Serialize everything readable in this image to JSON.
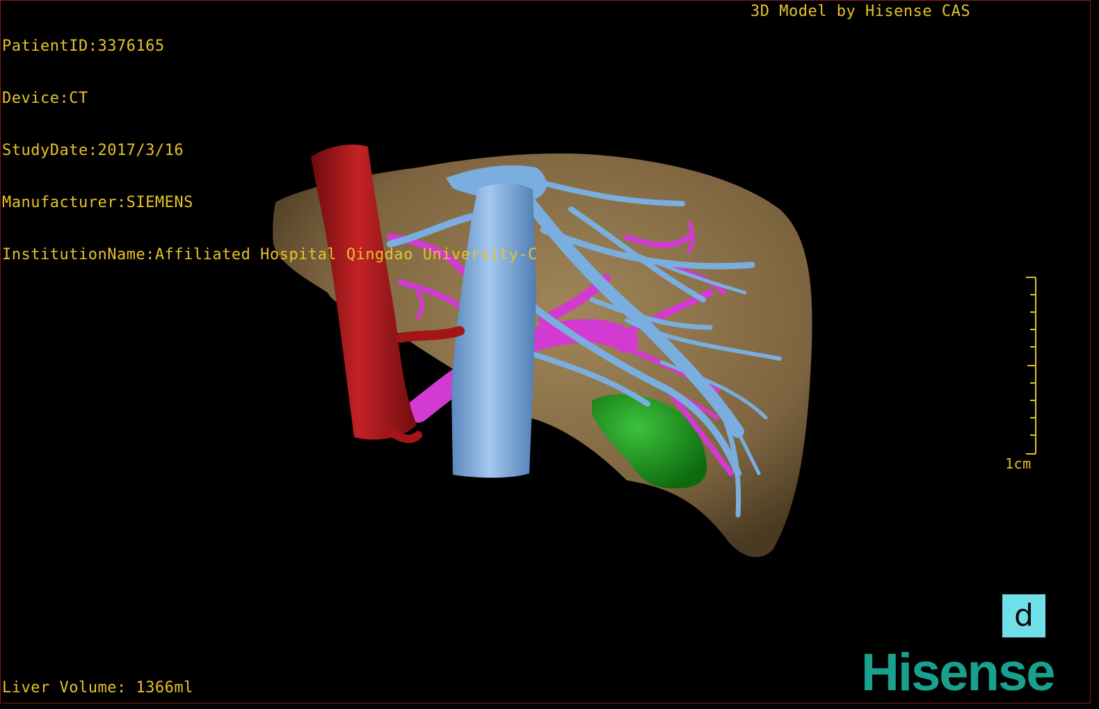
{
  "info": {
    "patient_id": "PatientID:3376165",
    "device": "Device:CT",
    "study_date": "StudyDate:2017/3/16",
    "manufacturer": "Manufacturer:SIEMENS",
    "institution": "InstitutionName:Affiliated Hospital Qingdao University-C"
  },
  "brand_top": "3D Model by Hisense CAS",
  "liver_volume": "Liver Volume: 1366ml",
  "scale": {
    "label": "1cm"
  },
  "orientation": {
    "label": "d"
  },
  "logo": {
    "text": "Hisense"
  },
  "colors": {
    "overlay_text": "#e8c22a",
    "liver": "#8a7048",
    "inferior_vena_cava": "#7aaede",
    "aorta": "#a31518",
    "portal_vein": "#d23ad2",
    "tumor": "#1f9a1f",
    "orientation_cube": "#6fe0ea",
    "logo": "#1aa08e"
  }
}
